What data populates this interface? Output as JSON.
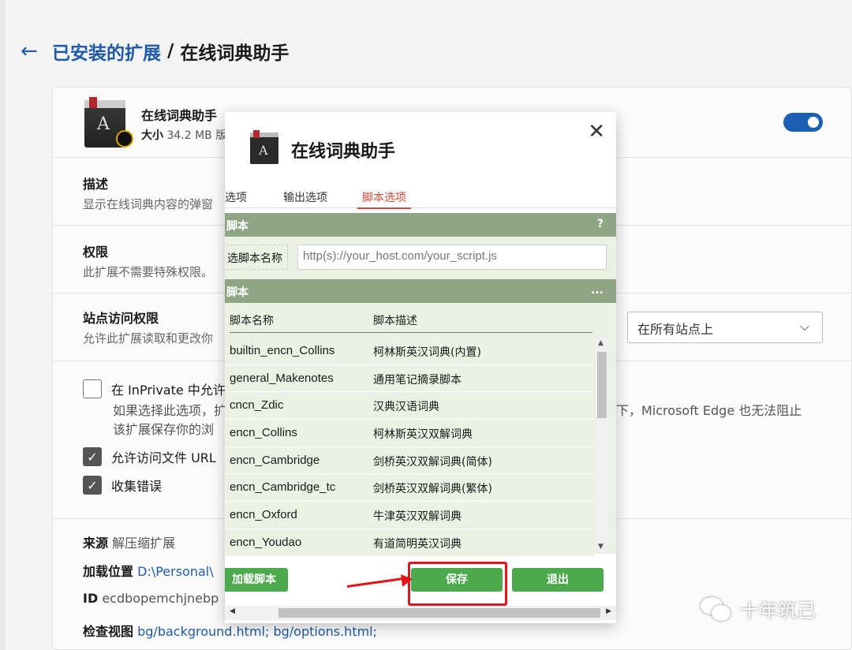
{
  "header": {
    "back_icon": "←",
    "breadcrumb_link": "已安装的扩展",
    "separator": "/",
    "current": "在线词典助手"
  },
  "extension": {
    "name": "在线词典助手",
    "size_label": "大小",
    "size_value": "34.2 MB",
    "size_trail": "版",
    "enabled": true
  },
  "sections": {
    "description": {
      "title": "描述",
      "text": "显示在线词典内容的弹窗"
    },
    "permissions": {
      "title": "权限",
      "text": "此扩展不需要特殊权限。"
    },
    "site_access": {
      "title": "站点访问权限",
      "text": "允许此扩展读取和更改你",
      "select_value": "在所有站点上",
      "select_icon": "⌵"
    }
  },
  "options": {
    "inprivate": {
      "label": "在 InPrivate 中允许",
      "checked": false,
      "desc_line1": "如果选择此选项，扩",
      "desc_line2": "该扩展保存你的浏",
      "desc_right": "下，Microsoft Edge 也无法阻止"
    },
    "file_url": {
      "label": "允许访问文件 URL",
      "checked": true
    },
    "collect_errors": {
      "label": "收集错误",
      "checked": true
    }
  },
  "details": {
    "source_label": "来源",
    "source_value": "解压缩扩展",
    "load_label": "加载位置",
    "load_value": "D:\\Personal\\",
    "id_label": "ID",
    "id_value": "ecdbopemchjnebp",
    "inspect_label": "检查视图",
    "inspect_value": "bg/background.html; bg/options.html;"
  },
  "popup": {
    "title": "在线词典助手",
    "close_icon": "✕",
    "tabs": [
      "选项",
      "输出选项",
      "脚本选项"
    ],
    "active_tab": 2,
    "panel1_title": "脚本",
    "panel1_action": "?",
    "name_label": "选脚本名称",
    "url_placeholder": "http(s)://your_host.com/your_script.js",
    "panel2_title": "脚本",
    "panel2_action": "...",
    "table_headers": [
      "脚本名称",
      "脚本描述"
    ],
    "rows": [
      [
        "builtin_encn_Collins",
        "柯林斯英汉词典(内置)"
      ],
      [
        "general_Makenotes",
        "通用笔记摘录脚本"
      ],
      [
        "cncn_Zdic",
        "汉典汉语词典"
      ],
      [
        "encn_Collins",
        "柯林斯英汉双解词典"
      ],
      [
        "encn_Cambridge",
        "剑桥英汉双解词典(简体)"
      ],
      [
        "encn_Cambridge_tc",
        "剑桥英汉双解词典(繁体)"
      ],
      [
        "encn_Oxford",
        "牛津英汉双解词典"
      ],
      [
        "encn_Youdao",
        "有道简明英汉词典"
      ]
    ],
    "load_button": "加载脚本",
    "save_button": "保存",
    "exit_button": "退出"
  },
  "watermark": {
    "text": "十年筑己",
    "icon": "wechat-icon"
  }
}
